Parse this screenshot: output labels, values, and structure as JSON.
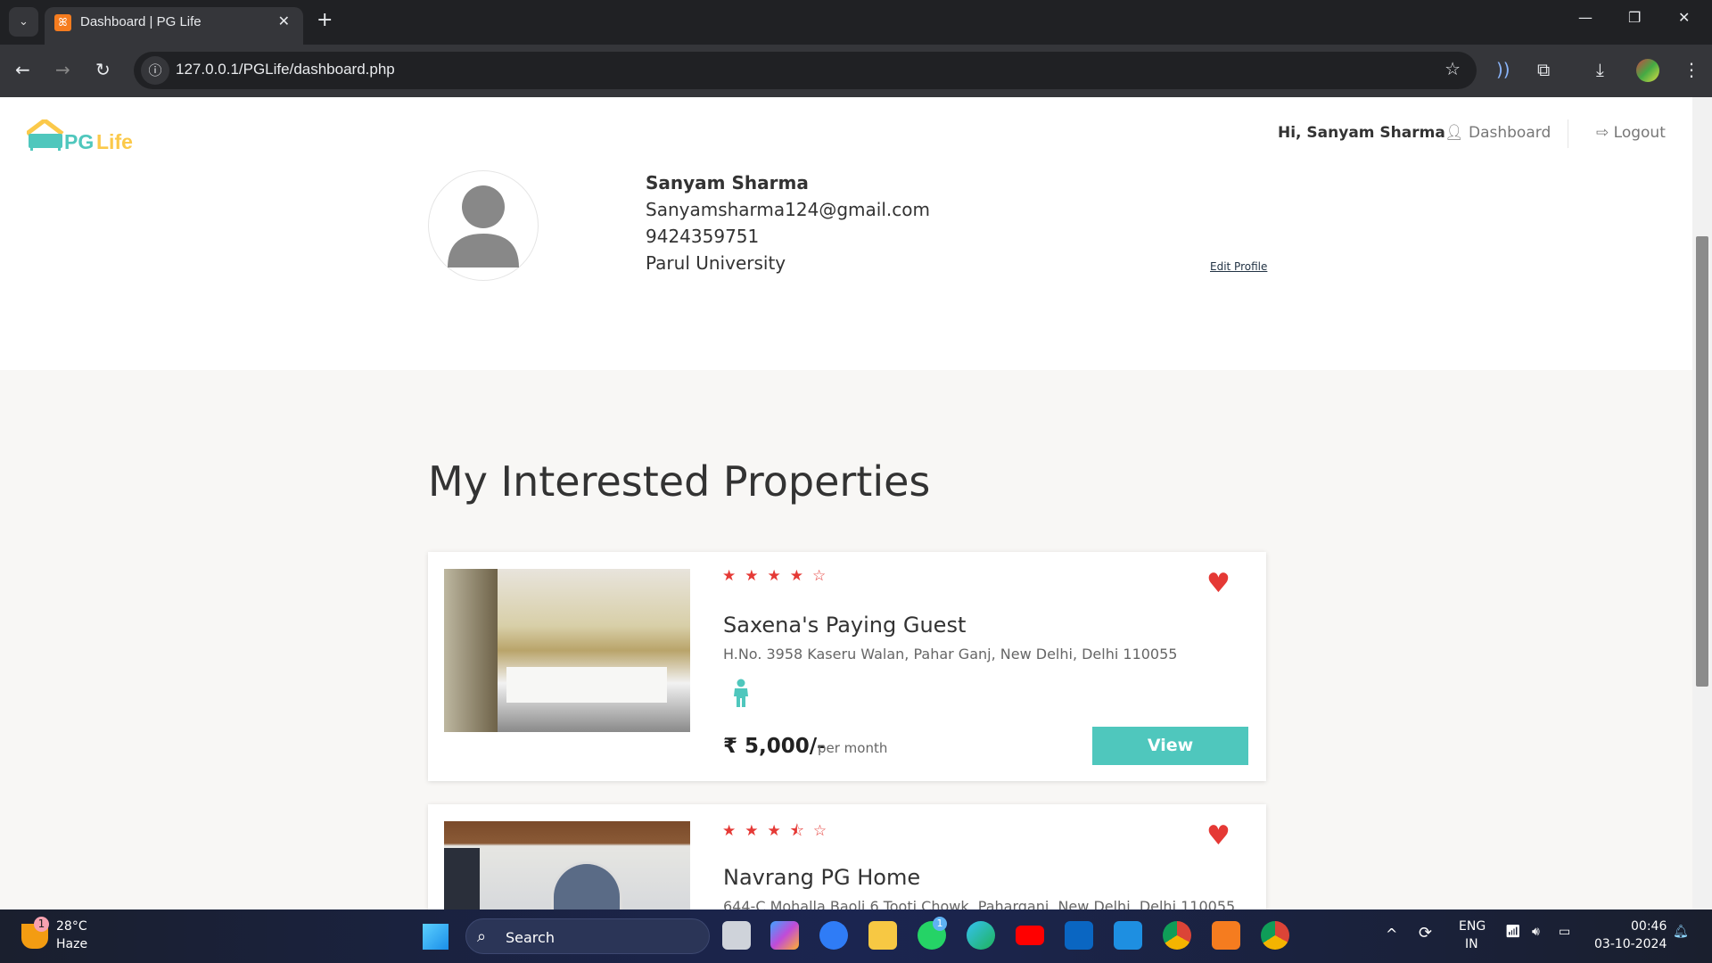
{
  "browser": {
    "tab_title": "Dashboard | PG Life",
    "url": "127.0.0.1/PGLife/dashboard.php"
  },
  "header": {
    "logo_text": "PG Life",
    "greeting": "Hi, Sanyam Sharma",
    "dashboard_label": "Dashboard",
    "logout_label": "Logout"
  },
  "profile": {
    "name": "Sanyam Sharma",
    "email": "Sanyamsharma124@gmail.com",
    "phone": "9424359751",
    "college": "Parul University",
    "edit_label": "Edit Profile"
  },
  "section_title": "My Interested Properties",
  "properties": [
    {
      "name": "Saxena's Paying Guest",
      "address": "H.No. 3958 Kaseru Walan, Pahar Ganj, New Delhi, Delhi 110055",
      "rating": 4,
      "gender_icon": "male-icon",
      "price": "₹ 5,000/-",
      "price_unit": "per month",
      "view_label": "View",
      "interested": true
    },
    {
      "name": "Navrang PG Home",
      "address": "644-C Mohalla Baoli 6 Tooti Chowk, Paharganj, New Delhi, Delhi 110055",
      "rating": 3.5,
      "interested": true
    }
  ],
  "taskbar": {
    "temp": "28°C",
    "weather": "Haze",
    "weather_badge": "1",
    "search": "Search",
    "lang1": "ENG",
    "lang2": "IN",
    "time": "00:46",
    "date": "03-10-2024",
    "whatsapp_badge": "1",
    "apps": [
      "task-view",
      "copilot",
      "app-store",
      "file-explorer",
      "whatsapp",
      "edge",
      "youtube",
      "linkedin",
      "vscode",
      "chrome",
      "xampp",
      "chrome-profile"
    ]
  },
  "colors": {
    "accent": "#4fc7bd",
    "star": "#e53935",
    "logo_yellow": "#fbc94a"
  }
}
